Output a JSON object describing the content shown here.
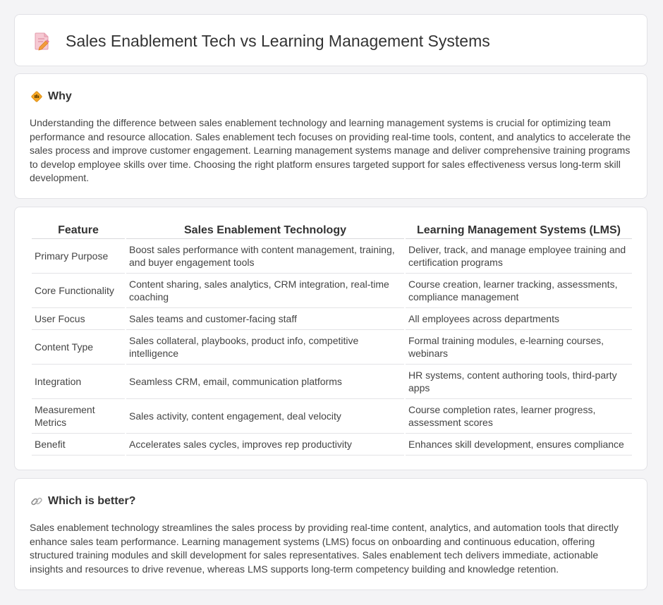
{
  "title": "Sales Enablement Tech vs Learning Management Systems",
  "why": {
    "heading": "Why",
    "text": "Understanding the difference between sales enablement technology and learning management systems is crucial for optimizing team performance and resource allocation. Sales enablement tech focuses on providing real-time tools, content, and analytics to accelerate the sales process and improve customer engagement. Learning management systems manage and deliver comprehensive training programs to develop employee skills over time. Choosing the right platform ensures targeted support for sales effectiveness versus long-term skill development."
  },
  "table": {
    "headers": [
      "Feature",
      "Sales Enablement Technology",
      "Learning Management Systems (LMS)"
    ],
    "rows": [
      [
        "Primary Purpose",
        "Boost sales performance with content management, training, and buyer engagement tools",
        "Deliver, track, and manage employee training and certification programs"
      ],
      [
        "Core Functionality",
        "Content sharing, sales analytics, CRM integration, real-time coaching",
        "Course creation, learner tracking, assessments, compliance management"
      ],
      [
        "User Focus",
        "Sales teams and customer-facing staff",
        "All employees across departments"
      ],
      [
        "Content Type",
        "Sales collateral, playbooks, product info, competitive intelligence",
        "Formal training modules, e-learning courses, webinars"
      ],
      [
        "Integration",
        "Seamless CRM, email, communication platforms",
        "HR systems, content authoring tools, third-party apps"
      ],
      [
        "Measurement Metrics",
        "Sales activity, content engagement, deal velocity",
        "Course completion rates, learner progress, assessment scores"
      ],
      [
        "Benefit",
        "Accelerates sales cycles, improves rep productivity",
        "Enhances skill development, ensures compliance"
      ]
    ]
  },
  "better": {
    "heading": "Which is better?",
    "text": "Sales enablement technology streamlines the sales process by providing real-time content, analytics, and automation tools that directly enhance sales team performance. Learning management systems (LMS) focus on onboarding and continuous education, offering structured training modules and skill development for sales representatives. Sales enablement tech delivers immediate, actionable insights and resources to drive revenue, whereas LMS supports long-term competency building and knowledge retention."
  },
  "icons": {
    "title": "document-pencil-icon",
    "why": "diamond-sign-icon",
    "better": "link-icon"
  },
  "colors": {
    "accent_pink": "#e8829a",
    "accent_orange": "#f39c3c"
  }
}
